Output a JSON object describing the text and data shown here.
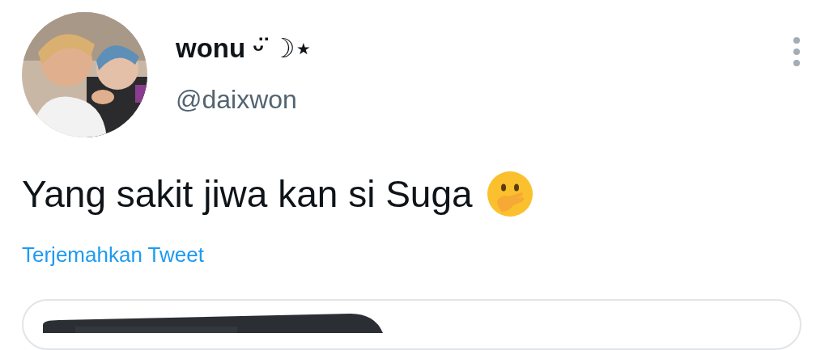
{
  "author": {
    "name": "wonu ᵕ̈ ☽⋆",
    "handle": "@daixwon"
  },
  "tweet": {
    "text": "Yang sakit jiwa kan si Suga"
  },
  "translate_link": "Terjemahkan Tweet"
}
